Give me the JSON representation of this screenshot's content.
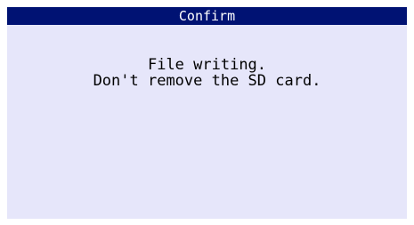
{
  "dialog": {
    "title": "Confirm",
    "message_lines": [
      "File writing.",
      "Don't remove the SD card."
    ]
  },
  "colors": {
    "titlebar_bg": "#001273",
    "titlebar_text": "#ffffff",
    "dialog_bg": "#e6e6fa",
    "text": "#000000"
  }
}
